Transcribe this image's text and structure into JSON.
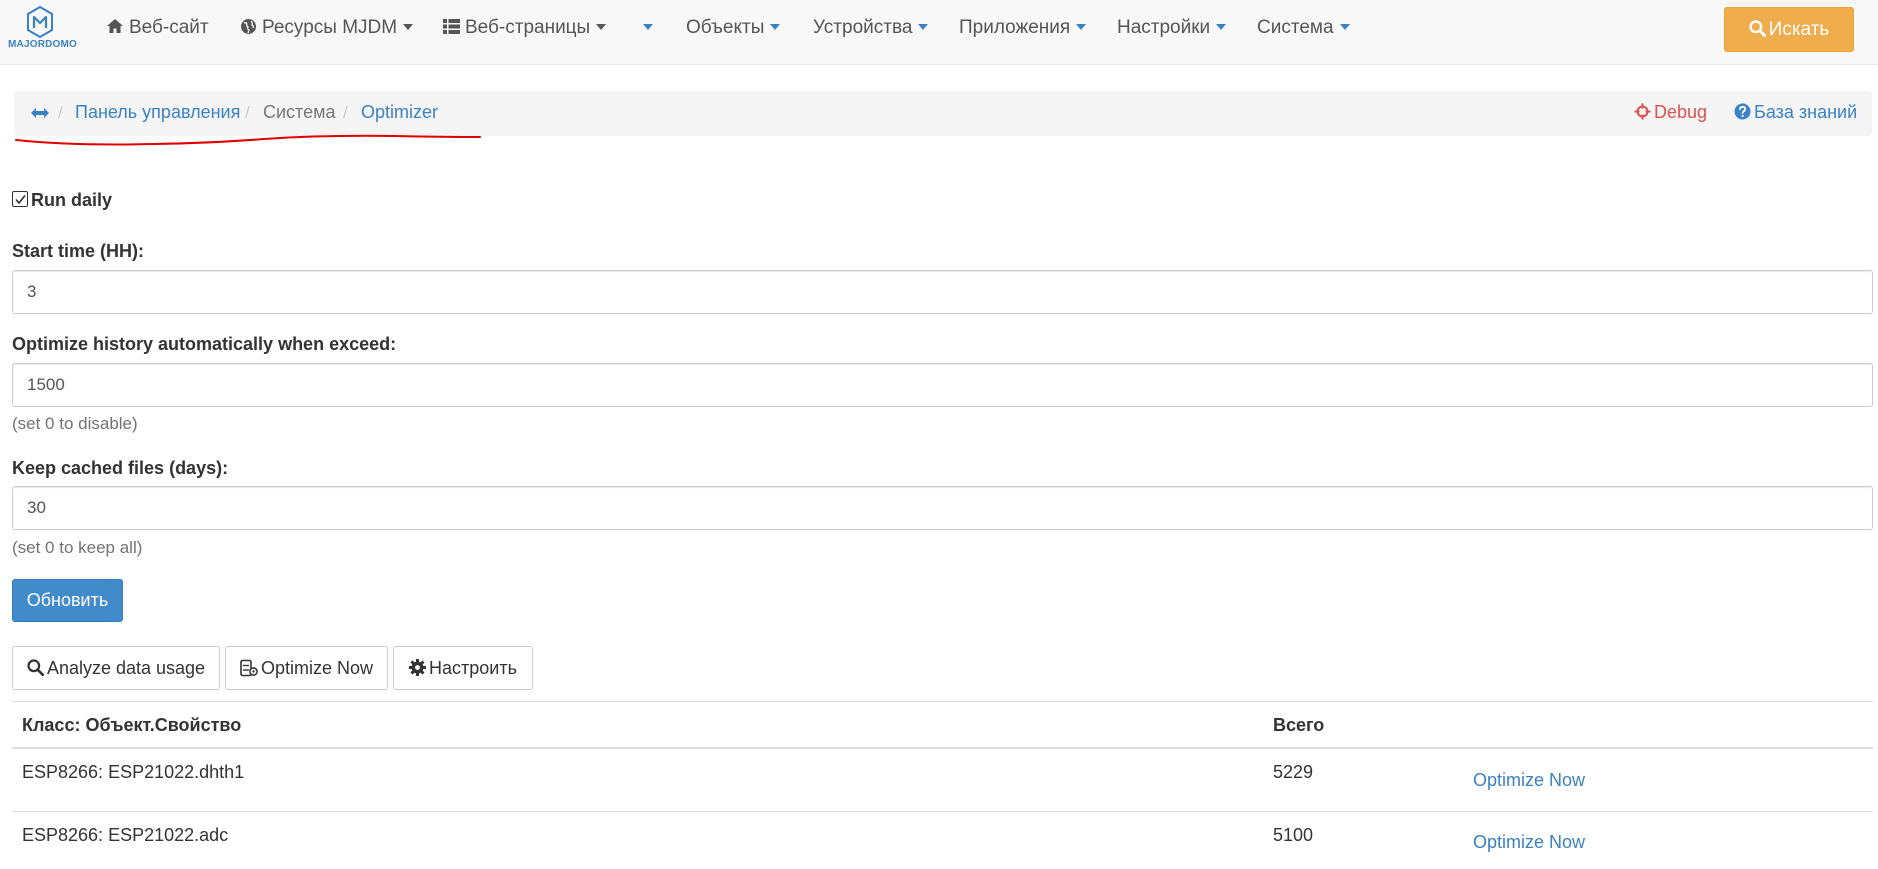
{
  "navbar": {
    "brand": "MAJORDOMO",
    "items": [
      {
        "label": "Веб-сайт",
        "icon": "home-icon"
      },
      {
        "label": "Ресурсы MJDM",
        "icon": "globe-icon"
      },
      {
        "label": "Веб-страницы",
        "icon": "list-icon"
      },
      {
        "label": "Объекты"
      },
      {
        "label": "Устройства"
      },
      {
        "label": "Приложения"
      },
      {
        "label": "Настройки"
      },
      {
        "label": "Система"
      }
    ],
    "search_label": "Искать"
  },
  "breadcrumb": {
    "items": [
      "Панель управления",
      "Система",
      "Optimizer"
    ],
    "debug_label": "Debug",
    "knowledge_label": "База знаний"
  },
  "form": {
    "run_daily_label": "Run daily",
    "run_daily_checked": true,
    "start_time_label": "Start time (HH):",
    "start_time_value": "3",
    "optimize_label": "Optimize history automatically when exceed:",
    "optimize_value": "1500",
    "optimize_help": "(set 0 to disable)",
    "keep_label": "Keep cached files (days):",
    "keep_value": "30",
    "keep_help": "(set 0 to keep all)",
    "update_label": "Обновить"
  },
  "toolbar": {
    "analyze_label": "Analyze data usage",
    "optimize_now_label": "Optimize Now",
    "configure_label": "Настроить"
  },
  "table": {
    "headers": [
      "Класс: Объект.Свойство",
      "Всего"
    ],
    "rows": [
      {
        "property": "ESP8266: ESP21022.dhth1",
        "total": "5229",
        "action": "Optimize Now"
      },
      {
        "property": "ESP8266: ESP21022.adc",
        "total": "5100",
        "action": "Optimize Now"
      }
    ]
  },
  "colors": {
    "accent": "#3a82c4",
    "search_button": "#f0ad4e",
    "primary_button": "#428bca",
    "debug": "#d9534f",
    "annotation": "#e00000"
  }
}
